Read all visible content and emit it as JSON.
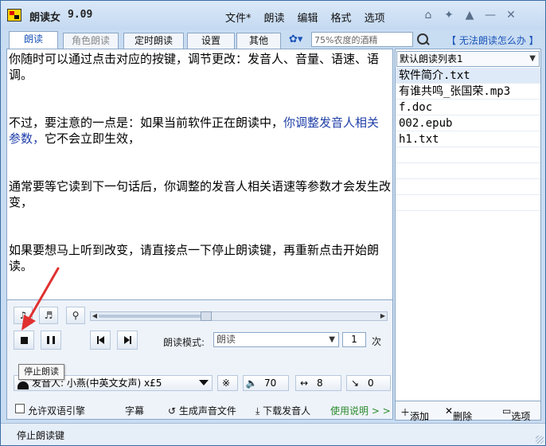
{
  "app": {
    "title": "朗读女",
    "version": "9.09"
  },
  "menu": [
    "文件*",
    "朗读",
    "编辑",
    "格式",
    "选项"
  ],
  "tabs": [
    {
      "label": "朗读",
      "state": "active"
    },
    {
      "label": "角色朗读",
      "state": "dim"
    },
    {
      "label": "定时朗读",
      "state": "normal"
    },
    {
      "label": "设置",
      "state": "normal"
    },
    {
      "label": "其他",
      "state": "normal"
    }
  ],
  "search": {
    "value": "75%农度的酒精"
  },
  "help_link": "【 无法朗读怎么办 】",
  "content": {
    "paragraphs": [
      {
        "text": "你随时可以通过点击对应的按键，调节更改：发音人、音量、语速、语调。"
      },
      {
        "pre": "不过，要注意的一点是：如果当前软件正在朗读中，",
        "highlight": "你调整发音人相关参数，",
        "post": "它不会立即生效，"
      },
      {
        "text": "通常要等它读到下一句话后，你调整的发音人相关语速等参数才会发生改变，"
      },
      {
        "text": "如果要想马上听到改变，请直接点一下停止朗读键，再重新点击开始朗读。"
      }
    ]
  },
  "playlist": {
    "selected_list": "默认朗读列表1",
    "items": [
      "软件简介.txt",
      "有谁共鸣_张国荣.mp3",
      "f.doc",
      "002.epub",
      "h1.txt"
    ]
  },
  "player": {
    "slider_progress": 0.38,
    "mode_label": "朗读模式:",
    "mode_value": "朗读",
    "repeat_count": "1",
    "repeat_unit": "次",
    "tooltip": "停止朗读"
  },
  "voice": {
    "label": "发音人:",
    "value": "小燕(中英文女声) x£5",
    "volume": "70",
    "speed": "8",
    "pitch": "0"
  },
  "options": {
    "bilingual": "允许双语引擎",
    "subtitle": "字幕",
    "generate_audio": "生成声音文件",
    "download_voice": "下载发音人",
    "instructions": "使用说明 > >"
  },
  "list_actions": {
    "add": "添加",
    "delete": "删除",
    "options": "选项"
  },
  "status": {
    "text": "停止朗读键"
  },
  "colors": {
    "accent": "#1a54b8",
    "highlight_text": "#1f3fa8",
    "instructions": "#2a8a2a",
    "arrow": "#e03030"
  }
}
